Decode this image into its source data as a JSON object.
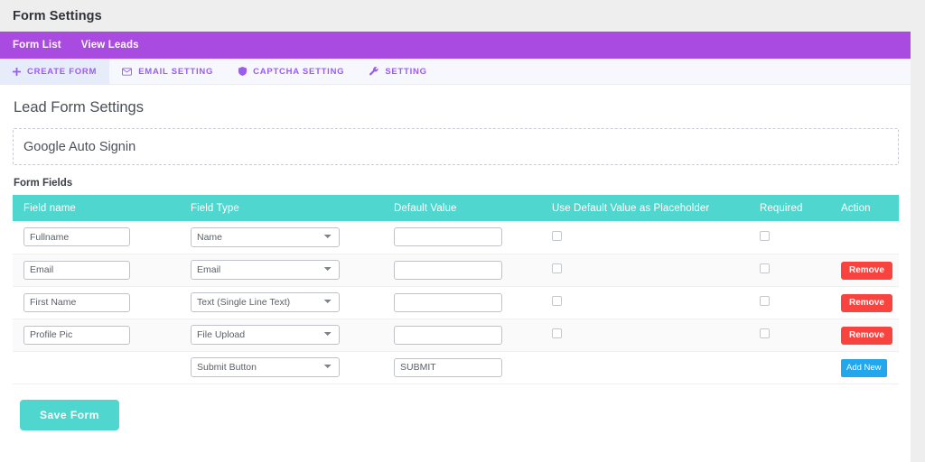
{
  "window": {
    "title": "Form Settings"
  },
  "navbar": {
    "items": [
      {
        "label": "Form List"
      },
      {
        "label": "View Leads"
      }
    ]
  },
  "tabs": [
    {
      "label": "CREATE FORM",
      "icon": "plus-icon",
      "active": true
    },
    {
      "label": "EMAIL SETTING",
      "icon": "envelope-icon",
      "active": false
    },
    {
      "label": "CAPTCHA SETTING",
      "icon": "shield-icon",
      "active": false
    },
    {
      "label": "SETTING",
      "icon": "wrench-icon",
      "active": false
    }
  ],
  "main": {
    "page_title": "Lead Form Settings",
    "form_name": {
      "value": "Google Auto Signin",
      "placeholder": "Form Name"
    },
    "section_label": "Form Fields",
    "table": {
      "headers": [
        "Field name",
        "Field Type",
        "Default Value",
        "Use Default Value as Placeholder",
        "Required",
        "Action"
      ],
      "rows": [
        {
          "field_name": "Fullname",
          "field_type": "Name",
          "default_value": "",
          "use_placeholder": false,
          "required": false,
          "action": null
        },
        {
          "field_name": "Email",
          "field_type": "Email",
          "default_value": "",
          "use_placeholder": false,
          "required": false,
          "action": "Remove"
        },
        {
          "field_name": "First Name",
          "field_type": "Text (Single Line Text)",
          "default_value": "",
          "use_placeholder": false,
          "required": false,
          "action": "Remove"
        },
        {
          "field_name": "Profile Pic",
          "field_type": "File Upload",
          "default_value": "",
          "use_placeholder": false,
          "required": false,
          "action": "Remove"
        }
      ],
      "submit_row": {
        "field_name": "",
        "field_type": "Submit Button",
        "default_value": "SUBMIT",
        "action": "Add New"
      }
    },
    "save_button": "Save Form"
  },
  "colors": {
    "navbar_purple": "#a94ae0",
    "tab_accent": "#9b5cf0",
    "table_header_teal": "#4fd6ce",
    "remove_red": "#f8433f",
    "addnew_blue": "#22a7ef"
  }
}
